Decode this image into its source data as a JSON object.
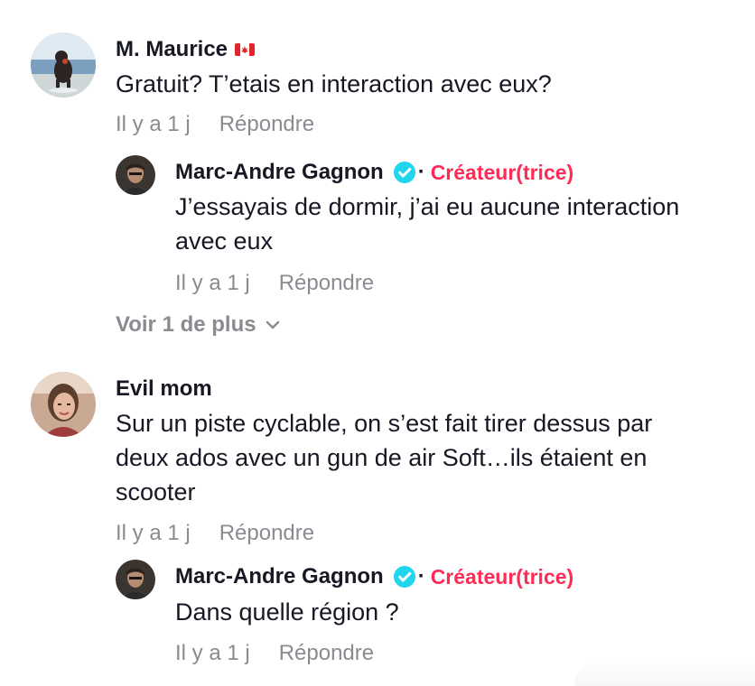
{
  "comments": [
    {
      "username": "M. Maurice",
      "flag": "canada-flag",
      "text": "Gratuit? T’etais en interaction avec eux?",
      "time": "Il y a 1 j",
      "reply_label": "Répondre",
      "replies": [
        {
          "username": "Marc-Andre Gagnon",
          "verified": true,
          "separator": "·",
          "creator_label": "Créateur(trice)",
          "text_lines": [
            "J’essayais de dormir, j’ai eu aucune interaction",
            "avec eux"
          ],
          "time": "Il y a 1 j",
          "reply_label": "Répondre"
        }
      ],
      "more_label": "Voir 1 de plus"
    },
    {
      "username": "Evil mom",
      "text_lines": [
        "Sur un piste cyclable, on s’est fait tirer dessus par",
        "deux ados avec un gun de air Soft…ils étaient en",
        "scooter"
      ],
      "time": "Il y a 1 j",
      "reply_label": "Répondre",
      "replies": [
        {
          "username": "Marc-Andre Gagnon",
          "verified": true,
          "separator": "·",
          "creator_label": "Créateur(trice)",
          "text": "Dans quelle région ?",
          "time": "Il y a 1 j",
          "reply_label": "Répondre"
        }
      ]
    }
  ],
  "colors": {
    "creator": "#fe2c55",
    "verified": "#20d5ec",
    "meta": "#8a8b91",
    "text": "#161823"
  },
  "icons": {
    "verified": "verified-badge-icon",
    "chevron": "chevron-down-icon"
  }
}
